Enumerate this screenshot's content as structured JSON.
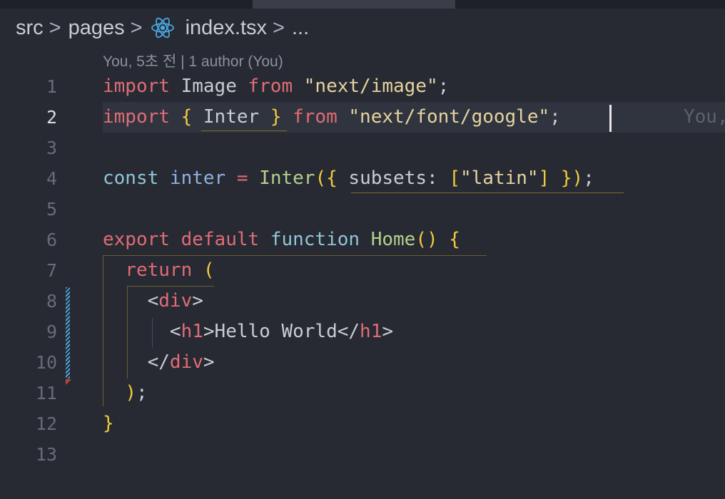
{
  "breadcrumb": {
    "items": [
      "src",
      "pages",
      "index.tsx",
      "..."
    ],
    "separator": ">",
    "file_icon": "react-icon"
  },
  "blame": {
    "header": "You, 5초 전 | 1 author (You)",
    "inline": "You,"
  },
  "editor": {
    "active_line": 2,
    "line_numbers": [
      "1",
      "2",
      "3",
      "4",
      "5",
      "6",
      "7",
      "8",
      "9",
      "10",
      "11",
      "12",
      "13"
    ],
    "lines": [
      [
        {
          "t": "import",
          "c": "kw"
        },
        {
          "t": " Image ",
          "c": "ident"
        },
        {
          "t": "from",
          "c": "kw"
        },
        {
          "t": " \"next/image\"",
          "c": "str2"
        },
        {
          "t": ";",
          "c": "punct"
        }
      ],
      [
        {
          "t": "import",
          "c": "kw"
        },
        {
          "t": " ",
          "c": "ident"
        },
        {
          "t": "{",
          "c": "brace"
        },
        {
          "t": " Inter ",
          "c": "ident"
        },
        {
          "t": "}",
          "c": "brace"
        },
        {
          "t": " ",
          "c": "ident"
        },
        {
          "t": "from",
          "c": "kw"
        },
        {
          "t": " \"next/font/google\"",
          "c": "str2"
        },
        {
          "t": ";",
          "c": "punct"
        }
      ],
      [],
      [
        {
          "t": "const",
          "c": "cyan"
        },
        {
          "t": " ",
          "c": "ident"
        },
        {
          "t": "inter",
          "c": "blue"
        },
        {
          "t": " ",
          "c": "ident"
        },
        {
          "t": "=",
          "c": "op"
        },
        {
          "t": " ",
          "c": "ident"
        },
        {
          "t": "Inter",
          "c": "fn"
        },
        {
          "t": "(",
          "c": "brace"
        },
        {
          "t": "{",
          "c": "brace"
        },
        {
          "t": " subsets: ",
          "c": "ident"
        },
        {
          "t": "[",
          "c": "brace"
        },
        {
          "t": "\"latin\"",
          "c": "str2"
        },
        {
          "t": "]",
          "c": "brace"
        },
        {
          "t": " ",
          "c": "ident"
        },
        {
          "t": "}",
          "c": "brace"
        },
        {
          "t": ")",
          "c": "brace"
        },
        {
          "t": ";",
          "c": "punct"
        }
      ],
      [],
      [
        {
          "t": "export",
          "c": "kw"
        },
        {
          "t": " ",
          "c": "ident"
        },
        {
          "t": "default",
          "c": "kw"
        },
        {
          "t": " ",
          "c": "ident"
        },
        {
          "t": "function",
          "c": "cyan"
        },
        {
          "t": " ",
          "c": "ident"
        },
        {
          "t": "Home",
          "c": "fn"
        },
        {
          "t": "()",
          "c": "brace"
        },
        {
          "t": " ",
          "c": "ident"
        },
        {
          "t": "{",
          "c": "brace"
        }
      ],
      [
        {
          "t": "  ",
          "c": "ident"
        },
        {
          "t": "return",
          "c": "kw"
        },
        {
          "t": " ",
          "c": "ident"
        },
        {
          "t": "(",
          "c": "brace"
        }
      ],
      [
        {
          "t": "    <",
          "c": "punct"
        },
        {
          "t": "div",
          "c": "tag"
        },
        {
          "t": ">",
          "c": "punct"
        }
      ],
      [
        {
          "t": "      <",
          "c": "punct"
        },
        {
          "t": "h1",
          "c": "tag"
        },
        {
          "t": ">",
          "c": "punct"
        },
        {
          "t": "Hello World",
          "c": "ident"
        },
        {
          "t": "</",
          "c": "punct"
        },
        {
          "t": "h1",
          "c": "tag"
        },
        {
          "t": ">",
          "c": "punct"
        }
      ],
      [
        {
          "t": "    </",
          "c": "punct"
        },
        {
          "t": "div",
          "c": "tag"
        },
        {
          "t": ">",
          "c": "punct"
        }
      ],
      [
        {
          "t": "  ",
          "c": "ident"
        },
        {
          "t": ")",
          "c": "brace"
        },
        {
          "t": ";",
          "c": "punct"
        }
      ],
      [
        {
          "t": "}",
          "c": "brace"
        }
      ],
      []
    ]
  },
  "colors": {
    "background": "#272a33",
    "keyword": "#e06c75",
    "string": "#e5d3a0",
    "bracket": "#f2cc3a",
    "function": "#b5cf8a",
    "git_modified": "#4aa3d8",
    "git_deleted": "#c0413b"
  }
}
